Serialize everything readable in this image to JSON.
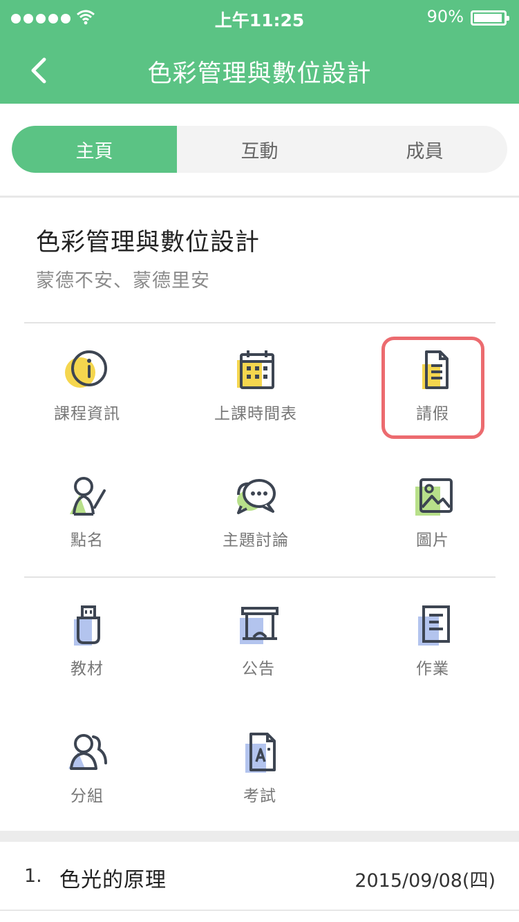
{
  "status_bar": {
    "time": "上午11:25",
    "battery": "90%"
  },
  "nav": {
    "title": "色彩管理與數位設計",
    "back_icon": "chevron-left-icon"
  },
  "tabs": [
    {
      "label": "主頁",
      "active": true
    },
    {
      "label": "互動",
      "active": false
    },
    {
      "label": "成員",
      "active": false
    }
  ],
  "course": {
    "title": "色彩管理與數位設計",
    "teachers": "蒙德不安、蒙德里安"
  },
  "features": [
    {
      "label": "課程資訊",
      "icon": "info-icon"
    },
    {
      "label": "上課時間表",
      "icon": "calendar-icon"
    },
    {
      "label": "請假",
      "icon": "document-icon"
    },
    {
      "label": "點名",
      "icon": "roll-call-icon"
    },
    {
      "label": "主題討論",
      "icon": "chat-bubbles-icon"
    },
    {
      "label": "圖片",
      "icon": "image-icon"
    },
    {
      "label": "教材",
      "icon": "usb-drive-icon"
    },
    {
      "label": "公告",
      "icon": "bulletin-board-icon"
    },
    {
      "label": "作業",
      "icon": "notebook-icon"
    },
    {
      "label": "分組",
      "icon": "group-icon"
    },
    {
      "label": "考試",
      "icon": "exam-paper-icon"
    }
  ],
  "lessons": [
    {
      "number": "1.",
      "title": "色光的原理",
      "date": "2015/09/08(四)"
    }
  ],
  "colors": {
    "brand_green": "#5bc384",
    "highlight_red": "#ec6b6f",
    "accent_yellow": "#f5d64e",
    "accent_green": "#b8e08a",
    "accent_blue": "#b3c4ee"
  }
}
